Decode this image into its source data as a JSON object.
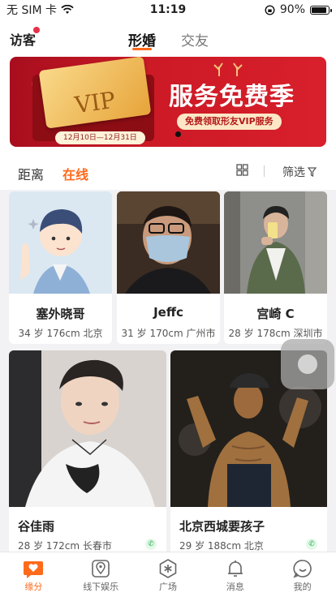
{
  "status_bar": {
    "carrier": "无 SIM 卡",
    "time": "11:19",
    "battery": "90%",
    "battery_level": 0.9
  },
  "header": {
    "visitor_label": "访客",
    "tabs": [
      "形婚",
      "交友"
    ],
    "active_tab": "形婚"
  },
  "banner": {
    "vip_text": "VIP",
    "title": "服务免费季",
    "subtitle": "免费领取形友VIP服务",
    "date_range": "12月10日—12月31日"
  },
  "filter": {
    "tabs": [
      "距离",
      "在线"
    ],
    "active": "在线",
    "filter_label": "筛选"
  },
  "cards": [
    {
      "name": "塞外晓哥",
      "info": "34 岁 176cm 北京"
    },
    {
      "name": "Jeffc",
      "info": "31 岁 170cm 广州市"
    },
    {
      "name": "宫崎 C",
      "info": "28 岁 178cm 深圳市"
    },
    {
      "name": "谷佳雨",
      "info": "28 岁  172cm  长春市"
    },
    {
      "name": "北京西城要孩子",
      "info": "29 岁  188cm  北京"
    }
  ],
  "tabbar": [
    {
      "label": "缘分",
      "icon": "heart-chat-icon",
      "active": true
    },
    {
      "label": "线下娱乐",
      "icon": "location-icon",
      "active": false
    },
    {
      "label": "广场",
      "icon": "asterisk-icon",
      "active": false
    },
    {
      "label": "消息",
      "icon": "bell-icon",
      "active": false
    },
    {
      "label": "我的",
      "icon": "smile-icon",
      "active": false
    }
  ],
  "colors": {
    "accent": "#ff6a1a",
    "banner_red": "#cc1a26"
  }
}
